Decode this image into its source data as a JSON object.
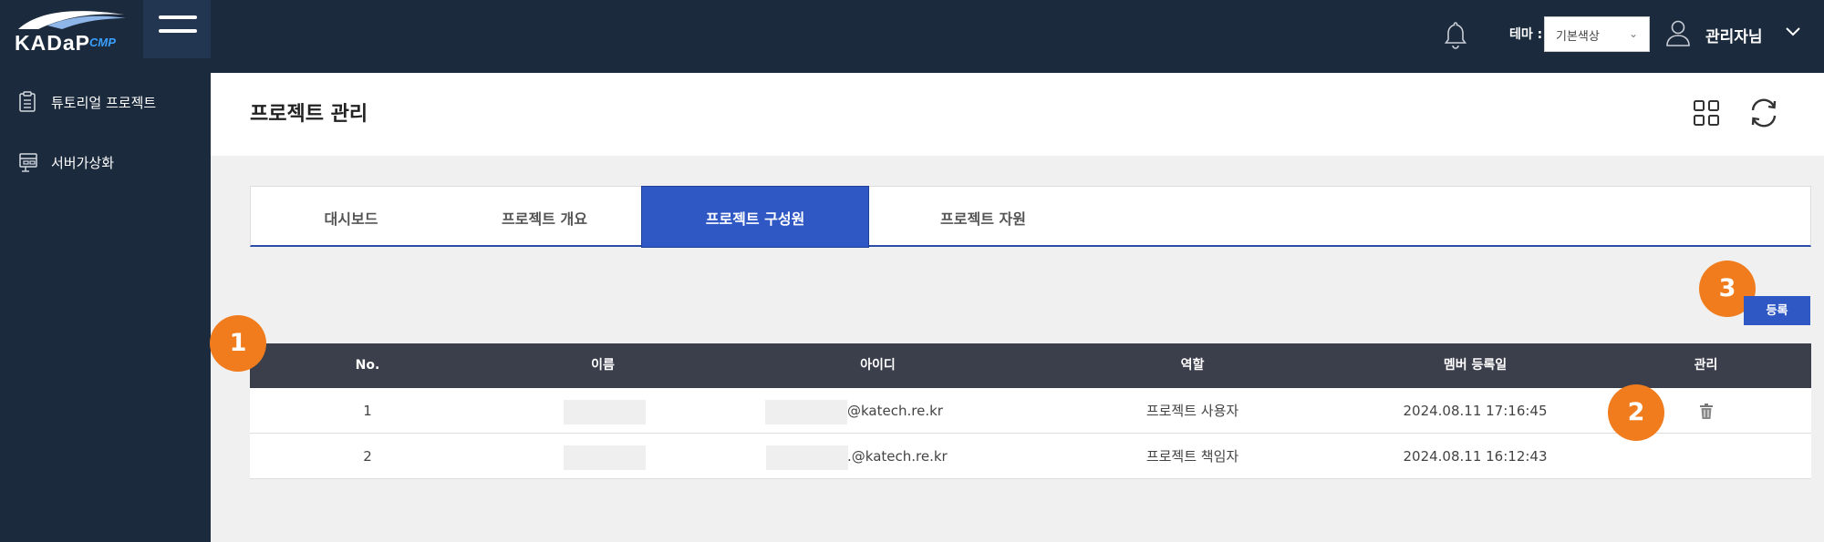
{
  "app": {
    "logo_text": "KADaP",
    "logo_sub": "CMP"
  },
  "topbar": {
    "theme_label": "테마 :",
    "theme_value": "기본색상",
    "user_name": "관리자님"
  },
  "sidebar": {
    "items": [
      {
        "label": "튜토리얼 프로젝트",
        "icon": "clipboard-icon"
      },
      {
        "label": "서버가상화",
        "icon": "server-virtualization-icon"
      }
    ]
  },
  "page": {
    "title": "프로젝트 관리"
  },
  "tabs": [
    {
      "label": "대시보드",
      "active": false
    },
    {
      "label": "프로젝트 개요",
      "active": false
    },
    {
      "label": "프로젝트 구성원",
      "active": true
    },
    {
      "label": "프로젝트 자원",
      "active": false
    }
  ],
  "badges": [
    "1",
    "2",
    "3"
  ],
  "register_label": "등록",
  "table": {
    "columns": [
      "No.",
      "이름",
      "아이디",
      "역할",
      "멤버 등록일",
      "관리"
    ],
    "rows": [
      {
        "no": "1",
        "name": "",
        "id": "@katech.re.kr",
        "role": "프로젝트 사용자",
        "date": "2024.08.11 17:16:45",
        "deletable": true
      },
      {
        "no": "2",
        "name": "",
        "id": ".@katech.re.kr",
        "role": "프로젝트 책임자",
        "date": "2024.08.11 16:12:43",
        "deletable": false
      }
    ]
  },
  "colors": {
    "sidebar_bg": "#1b2a3d",
    "accent": "#2f58c5",
    "badge": "#f07c1e",
    "table_header": "#3a3f4b"
  }
}
